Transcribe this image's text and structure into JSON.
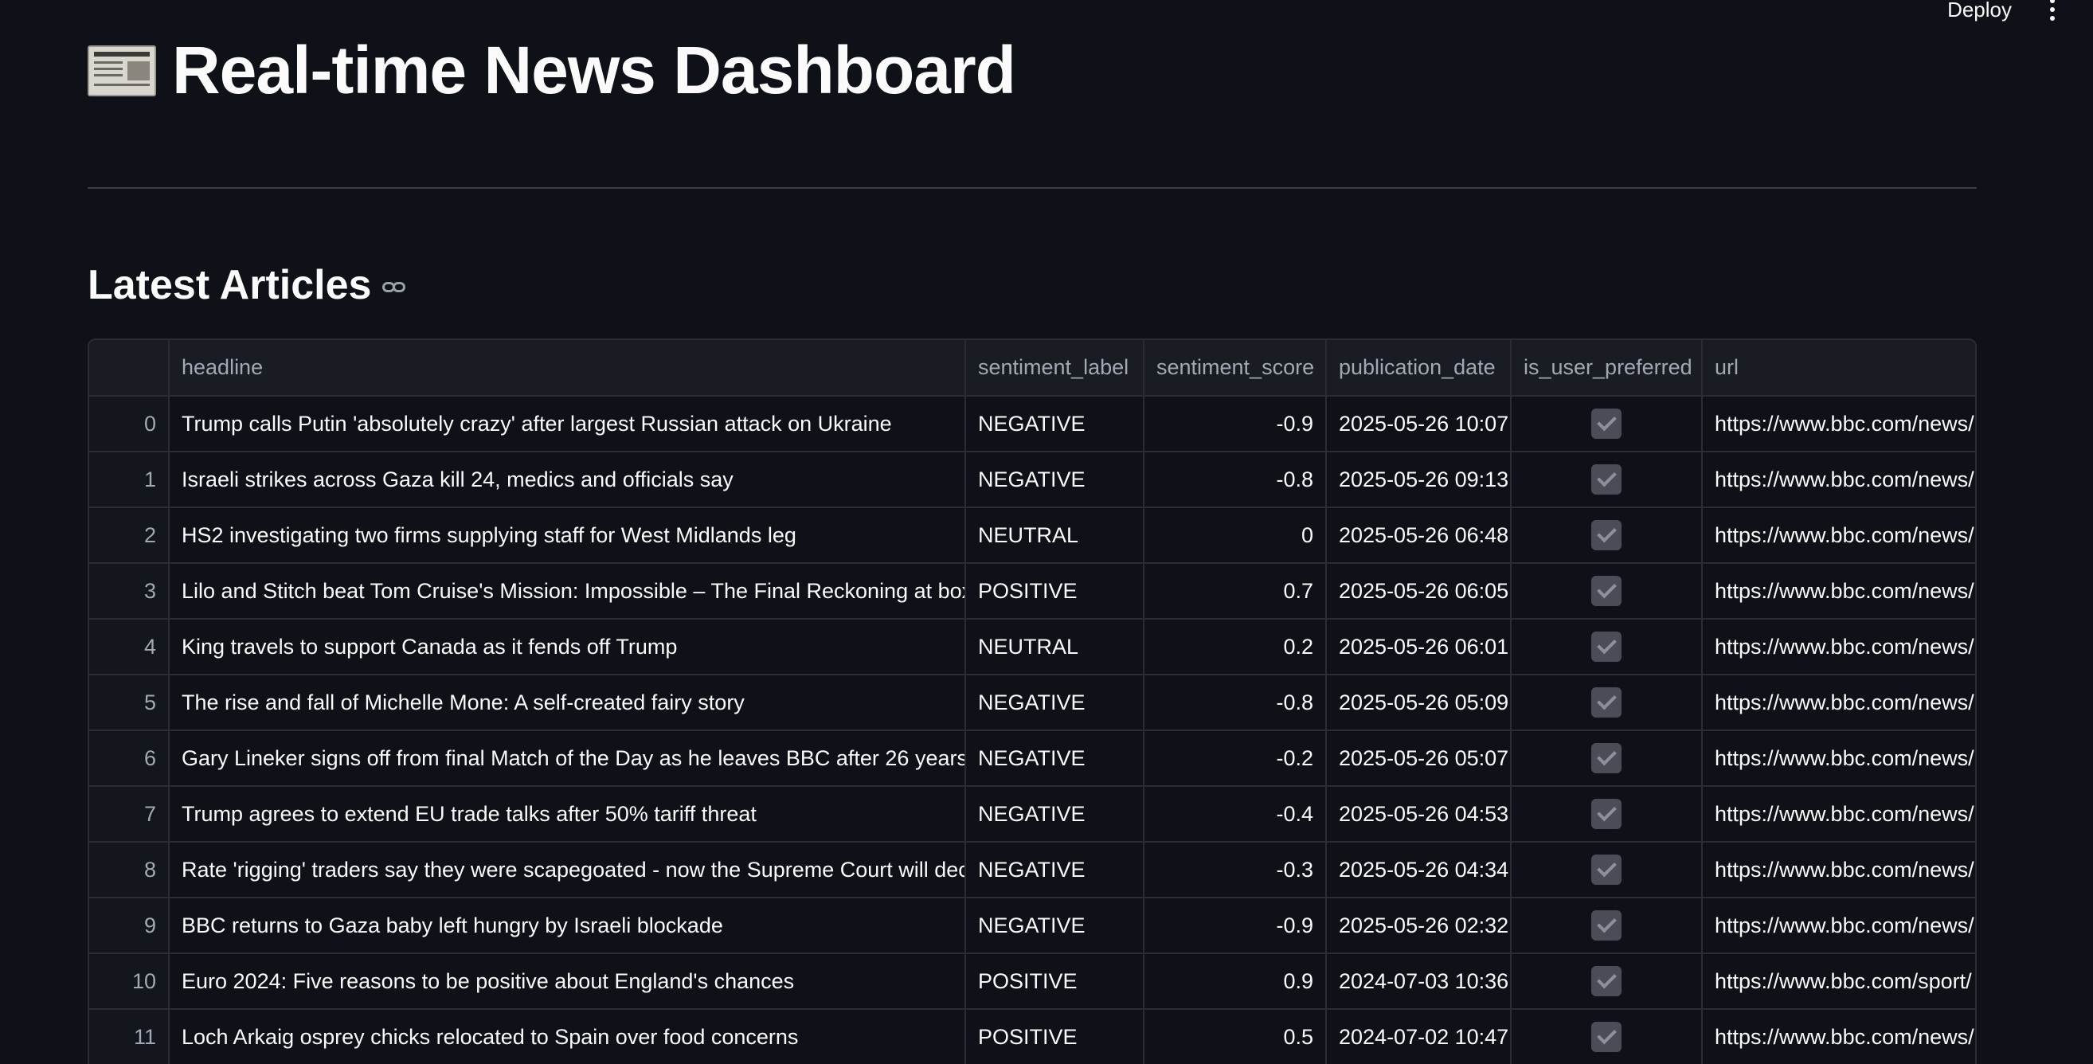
{
  "topbar": {
    "deploy_label": "Deploy"
  },
  "page": {
    "title": "Real-time News Dashboard",
    "title_icon": "newspaper-icon"
  },
  "section": {
    "title": "Latest Articles",
    "anchor_icon": "link-icon"
  },
  "table": {
    "columns": [
      "",
      "headline",
      "sentiment_label",
      "sentiment_score",
      "publication_date",
      "is_user_preferred",
      "url"
    ],
    "rows": [
      {
        "idx": "0",
        "headline": "Trump calls Putin 'absolutely crazy' after largest Russian attack on Ukraine",
        "label": "NEGATIVE",
        "score": "-0.9",
        "date": "2025-05-26 10:07",
        "preferred": true,
        "url": "https://www.bbc.com/news/"
      },
      {
        "idx": "1",
        "headline": "Israeli strikes across Gaza kill 24, medics and officials say",
        "label": "NEGATIVE",
        "score": "-0.8",
        "date": "2025-05-26 09:13",
        "preferred": true,
        "url": "https://www.bbc.com/news/"
      },
      {
        "idx": "2",
        "headline": "HS2 investigating two firms supplying staff for West Midlands leg",
        "label": "NEUTRAL",
        "score": "0",
        "date": "2025-05-26 06:48",
        "preferred": true,
        "url": "https://www.bbc.com/news/"
      },
      {
        "idx": "3",
        "headline": "Lilo and Stitch beat Tom Cruise's Mission: Impossible – The Final Reckoning at box office",
        "label": "POSITIVE",
        "score": "0.7",
        "date": "2025-05-26 06:05",
        "preferred": true,
        "url": "https://www.bbc.com/news/"
      },
      {
        "idx": "4",
        "headline": "King travels to support Canada as it fends off Trump",
        "label": "NEUTRAL",
        "score": "0.2",
        "date": "2025-05-26 06:01",
        "preferred": true,
        "url": "https://www.bbc.com/news/"
      },
      {
        "idx": "5",
        "headline": " The rise and fall of Michelle Mone: A self-created fairy story",
        "label": "NEGATIVE",
        "score": "-0.8",
        "date": "2025-05-26 05:09",
        "preferred": true,
        "url": "https://www.bbc.com/news/"
      },
      {
        "idx": "6",
        "headline": "Gary Lineker signs off from final Match of the Day as he leaves BBC after 26 years",
        "label": "NEGATIVE",
        "score": "-0.2",
        "date": "2025-05-26 05:07",
        "preferred": true,
        "url": "https://www.bbc.com/news/"
      },
      {
        "idx": "7",
        "headline": "Trump agrees to extend EU trade talks after 50% tariff threat",
        "label": "NEGATIVE",
        "score": "-0.4",
        "date": "2025-05-26 04:53",
        "preferred": true,
        "url": "https://www.bbc.com/news/"
      },
      {
        "idx": "8",
        "headline": "Rate 'rigging' traders say they were scapegoated - now the Supreme Court will decide",
        "label": "NEGATIVE",
        "score": "-0.3",
        "date": "2025-05-26 04:34",
        "preferred": true,
        "url": "https://www.bbc.com/news/"
      },
      {
        "idx": "9",
        "headline": "BBC returns to Gaza baby left hungry by Israeli blockade",
        "label": "NEGATIVE",
        "score": "-0.9",
        "date": "2025-05-26 02:32",
        "preferred": true,
        "url": "https://www.bbc.com/news/"
      },
      {
        "idx": "10",
        "headline": "Euro 2024: Five reasons to be positive about England's chances",
        "label": "POSITIVE",
        "score": "0.9",
        "date": "2024-07-03 10:36",
        "preferred": true,
        "url": "https://www.bbc.com/sport/"
      },
      {
        "idx": "11",
        "headline": "Loch Arkaig osprey chicks relocated to Spain over food concerns",
        "label": "POSITIVE",
        "score": "0.5",
        "date": "2024-07-02 10:47",
        "preferred": true,
        "url": "https://www.bbc.com/news/"
      }
    ]
  }
}
